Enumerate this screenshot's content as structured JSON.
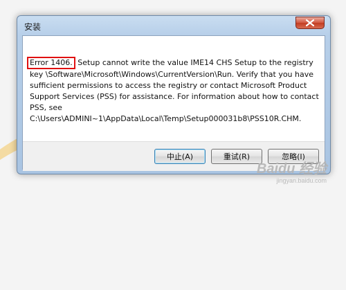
{
  "window": {
    "title": "安装",
    "close_icon": "close-icon"
  },
  "message": {
    "error_code": "Error 1406.",
    "text": " Setup cannot write the value IME14 CHS Setup to the registry key \\Software\\Microsoft\\Windows\\CurrentVersion\\Run.  Verify that you have sufficient permissions to access the registry or contact Microsoft Product Support Services (PSS) for assistance.  For information about how to contact PSS, see C:\\Users\\ADMINI~1\\AppData\\Local\\Temp\\Setup000031b8\\PSS10R.CHM."
  },
  "buttons": {
    "abort": "中止(A)",
    "retry": "重试(R)",
    "ignore": "忽略(I)"
  },
  "watermark": {
    "logo": "Baidu 经验",
    "url": "jingyan.baidu.com"
  },
  "colors": {
    "highlight_box": "#e01010",
    "title_bar": "#b7cfe9",
    "close_button": "#c23c22"
  }
}
